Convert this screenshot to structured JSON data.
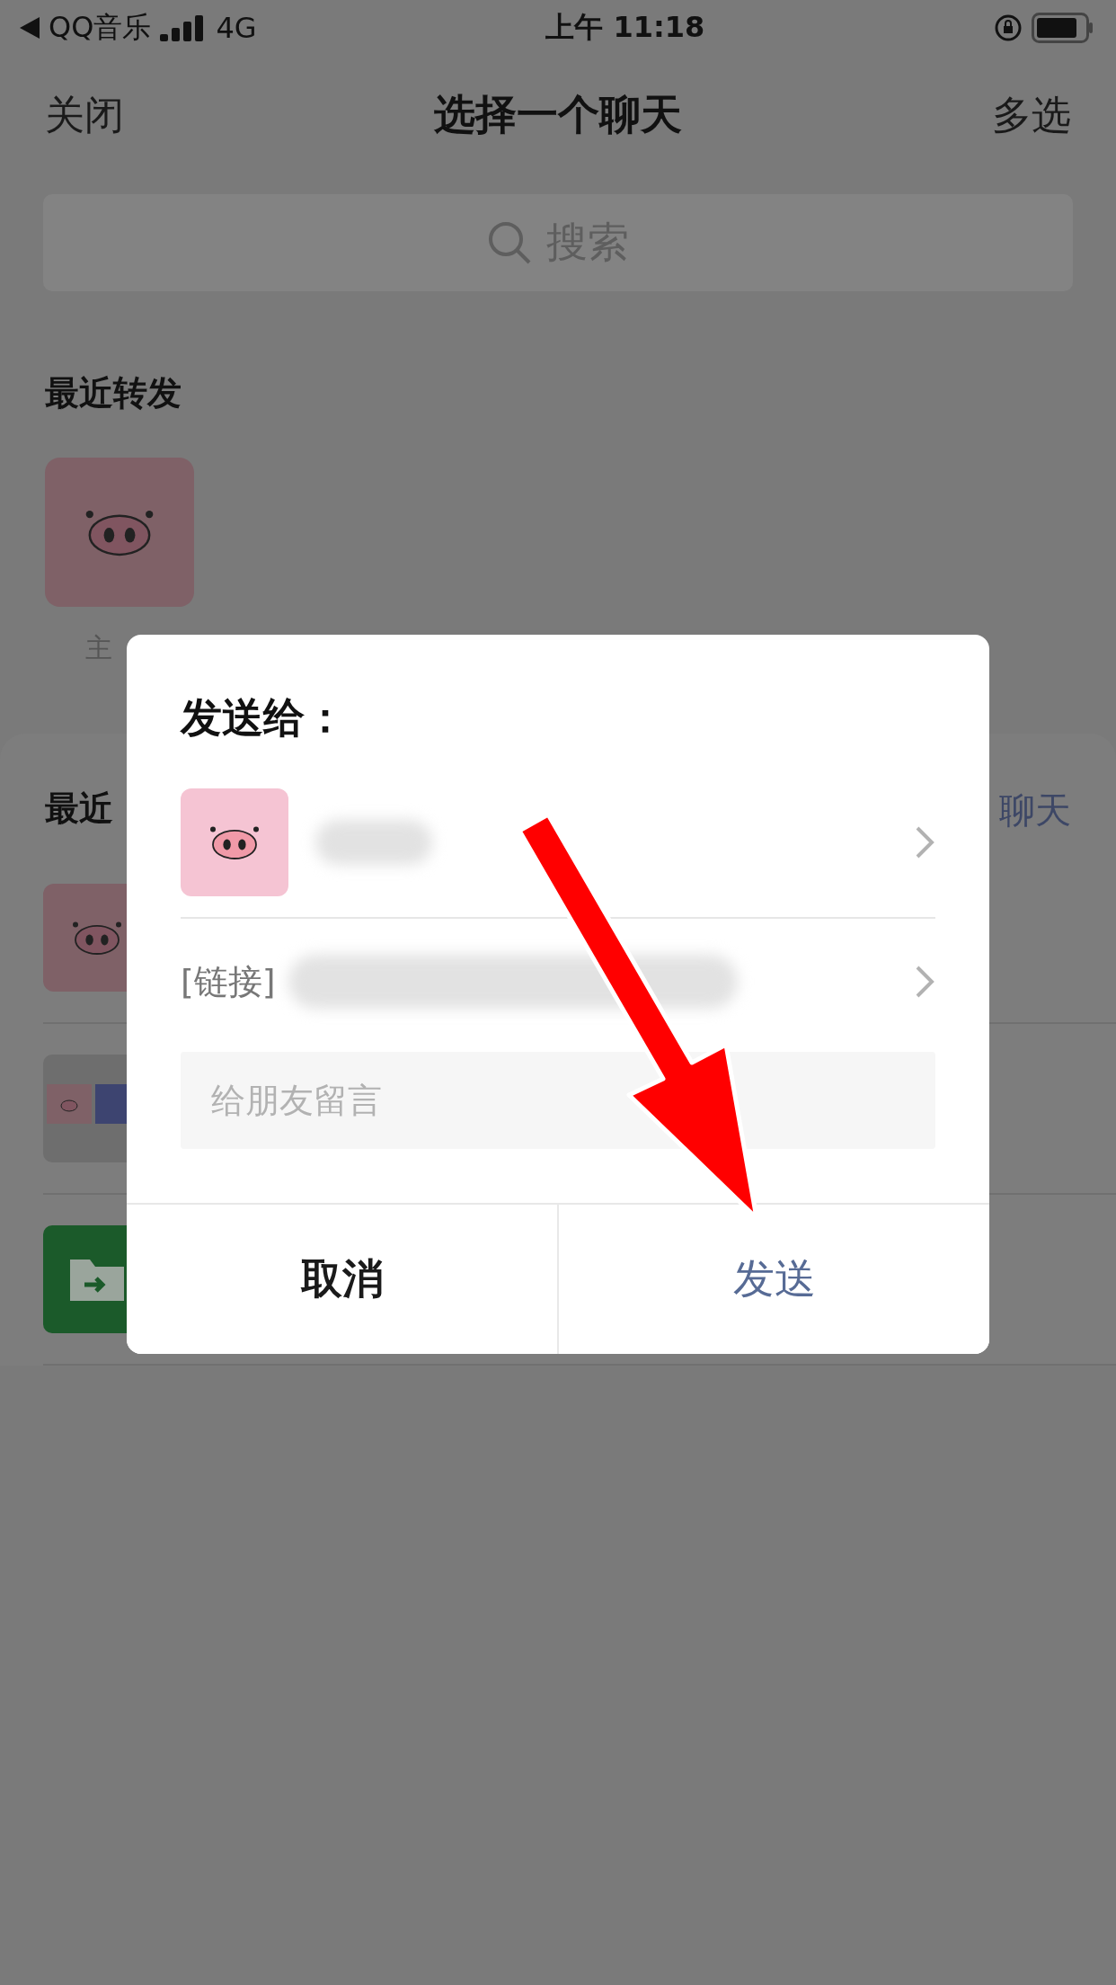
{
  "status_bar": {
    "app": "QQ音乐",
    "network": "4G",
    "time": "上午 11:18"
  },
  "nav": {
    "left": "关闭",
    "title": "选择一个聊天",
    "right": "多选"
  },
  "search": {
    "placeholder": "搜索"
  },
  "recent_forward": {
    "title": "最近转发",
    "contacts": [
      {
        "name": "主"
      }
    ]
  },
  "recent_chats": {
    "title": "最近",
    "action": "聊天",
    "rows": [
      {
        "kind": "pig"
      },
      {
        "kind": "thumbnail"
      },
      {
        "kind": "folder"
      }
    ]
  },
  "dialog": {
    "title": "发送给：",
    "link_label": "[链接]",
    "message": {
      "placeholder": "给朋友留言"
    },
    "buttons": [
      {
        "label": "取消",
        "kind": "cancel"
      },
      {
        "label": "发送",
        "kind": "primary"
      }
    ]
  }
}
